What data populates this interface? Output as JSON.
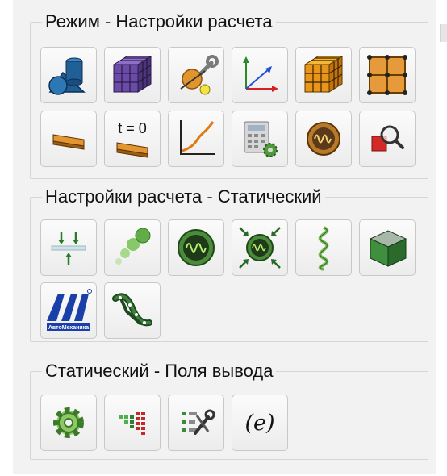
{
  "groups": [
    {
      "title": "Режим - Настройки расчета",
      "buttons": [
        {
          "icon": "solid-shapes-icon"
        },
        {
          "icon": "mesh-cube-icon"
        },
        {
          "icon": "tools-wrench-icon"
        },
        {
          "icon": "coordinate-axes-icon"
        },
        {
          "icon": "orange-mesh-cube-icon"
        },
        {
          "icon": "grid-frame-icon"
        },
        {
          "icon": "beam-icon"
        },
        {
          "icon": "initial-time-icon",
          "label": "t = 0"
        },
        {
          "icon": "graph-curve-icon"
        },
        {
          "icon": "calculator-gear-icon"
        },
        {
          "icon": "oscillation-icon"
        },
        {
          "icon": "magnifier-inspect-icon"
        }
      ]
    },
    {
      "title": "Настройки расчета - Статический",
      "buttons": [
        {
          "icon": "load-arrows-icon"
        },
        {
          "icon": "green-spheres-icon"
        },
        {
          "icon": "vibration-monitor-icon"
        },
        {
          "icon": "compression-monitor-icon"
        },
        {
          "icon": "spring-spiral-icon"
        },
        {
          "icon": "green-block-icon"
        },
        {
          "icon": "automechanika-logo-icon",
          "label": "АвтоМеханика"
        },
        {
          "icon": "frame-link-icon"
        }
      ]
    },
    {
      "title": "Статический - Поля вывода",
      "buttons": [
        {
          "icon": "settings-gear-icon"
        },
        {
          "icon": "color-bars-icon"
        },
        {
          "icon": "list-tools-icon"
        },
        {
          "icon": "expression-e-icon",
          "label": "(e)"
        }
      ]
    }
  ]
}
